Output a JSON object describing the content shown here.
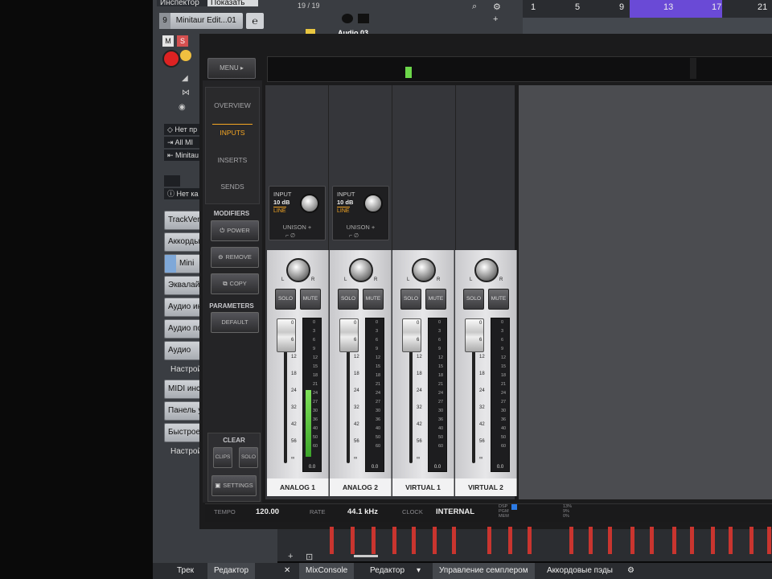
{
  "daw": {
    "inspector_tab_1": "Инспектор",
    "inspector_tab_2": "Показать",
    "track_number": "9",
    "track_name": "Minitaur Edit...01",
    "m_label": "M",
    "s_label": "S",
    "no_preset_1": "Нет пр",
    "all_midi": "All MI",
    "minitaur_short": "Minitau",
    "no_preset_2": "Нет ка",
    "panel_items": [
      "TrackVers",
      "Аккорды",
      "Mini",
      "Эквалайз",
      "Аудио ин",
      "Аудио по",
      "Аудио фе"
    ],
    "settings_1": "Настрой",
    "midi_ins": "MIDI инс",
    "panel_u": "Панель у",
    "quick": "Быстрое",
    "settings_2": "Настрой",
    "track_counter": "19 / 19",
    "track_label": "Audio 03",
    "ruler_ticks": [
      "1",
      "5",
      "9",
      "13",
      "17",
      "21"
    ],
    "bottom_tabs": [
      "Трек",
      "Редактор",
      "MixConsole",
      "Редактор",
      "Управление семплером",
      "Аккордовые пэды"
    ]
  },
  "console": {
    "menu": "MENU ▸",
    "nav": [
      "OVERVIEW",
      "INPUTS",
      "INSERTS",
      "SENDS"
    ],
    "nav_active": "INPUTS",
    "modifiers_label": "MODIFIERS",
    "power": "POWER",
    "remove": "REMOVE",
    "copy": "COPY",
    "parameters_label": "PARAMETERS",
    "default": "DEFAULT",
    "clear_label": "CLEAR",
    "clips": "CLIPS",
    "solo": "SOLO",
    "settings": "SETTINGS",
    "input_boxes": [
      {
        "label": "INPUT",
        "gain": "10 dB",
        "type": "LINE",
        "unison": "UNISON +"
      },
      {
        "label": "INPUT",
        "gain": "10 dB",
        "type": "LINE",
        "unison": "UNISON +"
      }
    ],
    "channels": [
      {
        "name": "ANALOG 1",
        "solo": "SOLO",
        "mute": "MUTE",
        "readout": "0.0",
        "level": 0.55
      },
      {
        "name": "ANALOG 2",
        "solo": "SOLO",
        "mute": "MUTE",
        "readout": "0.0",
        "level": 0
      },
      {
        "name": "VIRTUAL 1",
        "solo": "SOLO",
        "mute": "MUTE",
        "readout": "0.0",
        "level": 0
      },
      {
        "name": "VIRTUAL 2",
        "solo": "SOLO",
        "mute": "MUTE",
        "readout": "0.0",
        "level": 0
      }
    ],
    "pan_l": "L",
    "pan_r": "R",
    "fader_scale": [
      "0",
      "6",
      "12",
      "18",
      "24",
      "32",
      "42",
      "56",
      "∞"
    ],
    "meter_scale": [
      "0",
      "3",
      "6",
      "9",
      "12",
      "15",
      "18",
      "21",
      "24",
      "27",
      "30",
      "36",
      "40",
      "50",
      "60"
    ],
    "status": {
      "tempo_label": "TEMPO",
      "tempo_value": "120.00",
      "rate_label": "RATE",
      "rate_value": "44.1 kHz",
      "clock_label": "CLOCK",
      "clock_value": "INTERNAL",
      "dsp": "DSP",
      "pgm": "PGM",
      "mem": "MEM",
      "dsp_pct": "13%",
      "pgm_pct": "9%",
      "mem_pct": "0%"
    }
  }
}
